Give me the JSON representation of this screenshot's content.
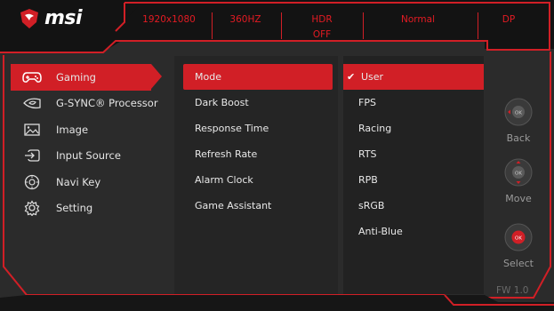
{
  "brand": {
    "name": "msi"
  },
  "status_bar": [
    {
      "id": "resolution",
      "text": "1920x1080"
    },
    {
      "id": "refresh",
      "text": "360HZ"
    },
    {
      "id": "hdr",
      "text": "HDR\nOFF",
      "line1": "HDR",
      "line2": "OFF"
    },
    {
      "id": "mode",
      "text": "Normal"
    },
    {
      "id": "input",
      "text": "DP"
    }
  ],
  "main_menu": [
    {
      "label": "Gaming",
      "icon": "gamepad-icon",
      "active": true
    },
    {
      "label": "G-SYNC® Processor",
      "icon": "nvidia-icon",
      "active": false
    },
    {
      "label": "Image",
      "icon": "image-icon",
      "active": false
    },
    {
      "label": "Input Source",
      "icon": "input-source-icon",
      "active": false
    },
    {
      "label": "Navi Key",
      "icon": "navi-key-icon",
      "active": false
    },
    {
      "label": "Setting",
      "icon": "gear-icon",
      "active": false
    }
  ],
  "sub_menu": [
    {
      "label": "Mode",
      "active": true
    },
    {
      "label": "Dark Boost",
      "active": false
    },
    {
      "label": "Response Time",
      "active": false
    },
    {
      "label": "Refresh Rate",
      "active": false
    },
    {
      "label": "Alarm Clock",
      "active": false
    },
    {
      "label": "Game Assistant",
      "active": false
    }
  ],
  "options": [
    {
      "label": "User",
      "selected": true
    },
    {
      "label": "FPS",
      "selected": false
    },
    {
      "label": "Racing",
      "selected": false
    },
    {
      "label": "RTS",
      "selected": false
    },
    {
      "label": "RPB",
      "selected": false
    },
    {
      "label": "sRGB",
      "selected": false
    },
    {
      "label": "Anti-Blue",
      "selected": false
    }
  ],
  "controls": {
    "back": {
      "label": "Back",
      "icon": "joystick-back-icon",
      "center": "OK"
    },
    "move": {
      "label": "Move",
      "icon": "joystick-move-icon",
      "center": "OK"
    },
    "select": {
      "label": "Select",
      "icon": "joystick-select-icon",
      "center": "OK"
    }
  },
  "firmware": "FW 1.0",
  "colors": {
    "accent": "#d11f26",
    "panel": "#2b2b2b",
    "text": "#e8e8e8",
    "muted": "#9a9a9a"
  }
}
